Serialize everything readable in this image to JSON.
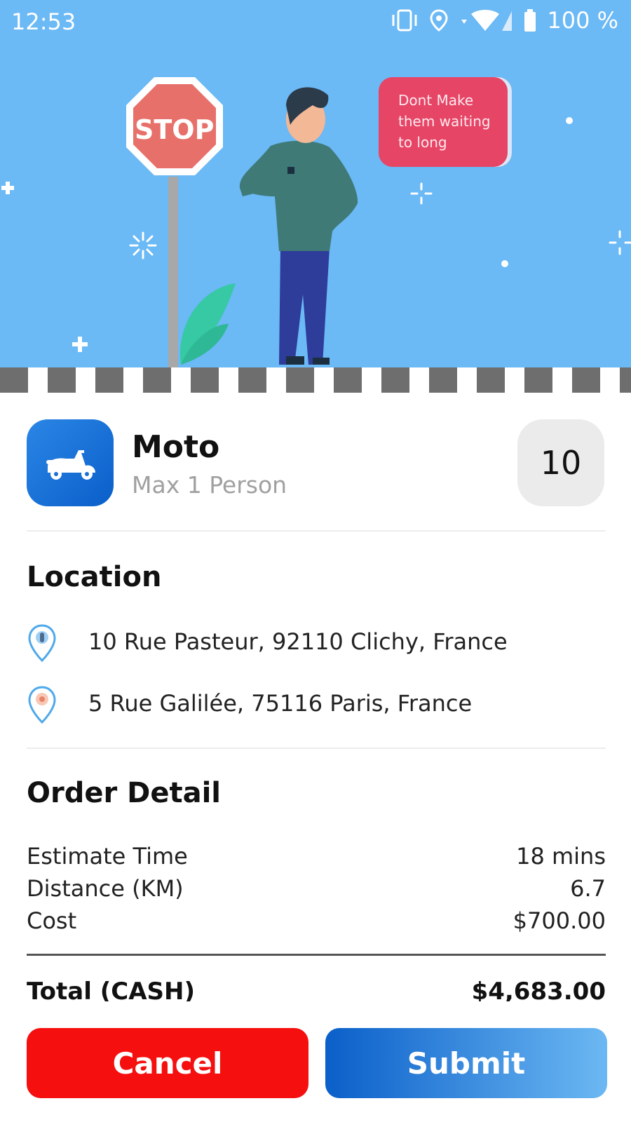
{
  "status_bar": {
    "time": "12:53",
    "battery": "100 %"
  },
  "hero": {
    "sign_text": "STOP",
    "bubble_text": "Dont Make them waiting to long"
  },
  "vehicle": {
    "name": "Moto",
    "capacity": "Max 1 Person",
    "count": "10",
    "icon": "scooter-icon"
  },
  "location": {
    "title": "Location",
    "pickup": "10 Rue Pasteur, 92110 Clichy, France",
    "dropoff": "5 Rue Galilée, 75116 Paris, France"
  },
  "order": {
    "title": "Order Detail",
    "rows": [
      {
        "label": "Estimate Time",
        "value": "18 mins"
      },
      {
        "label": "Distance (KM)",
        "value": "6.7"
      },
      {
        "label": "Cost",
        "value": "$700.00"
      }
    ],
    "total_label": "Total (CASH)",
    "total_value": "$4,683.00"
  },
  "actions": {
    "cancel": "Cancel",
    "submit": "Submit"
  },
  "colors": {
    "hero_bg": "#6bb9f5",
    "cancel": "#f50f0f",
    "submit": "#0a5fc9"
  }
}
